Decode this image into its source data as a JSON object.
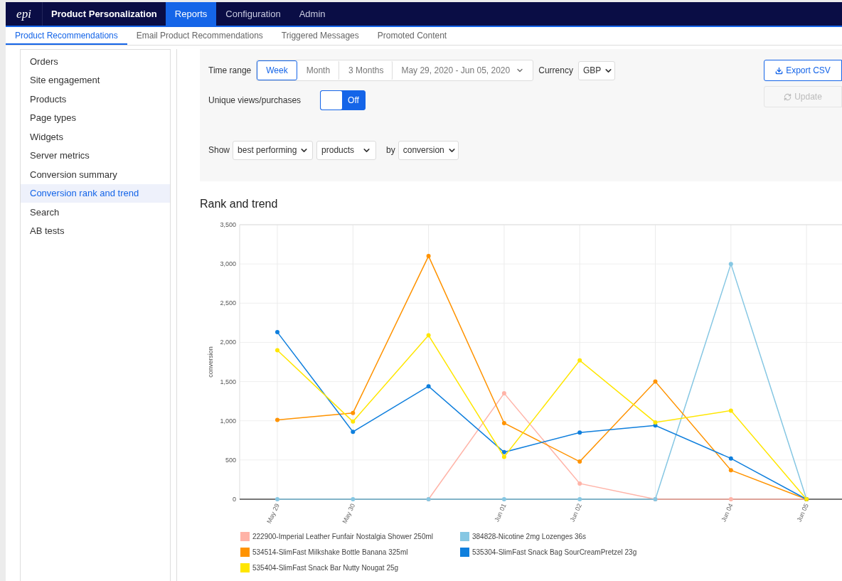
{
  "top_nav": {
    "logo": "epi",
    "product": "Product Personalization",
    "items": [
      {
        "label": "Reports",
        "selected": true
      },
      {
        "label": "Configuration",
        "selected": false
      },
      {
        "label": "Admin",
        "selected": false
      }
    ]
  },
  "sub_tabs": [
    {
      "label": "Product Recommendations",
      "selected": true
    },
    {
      "label": "Email Product Recommendations",
      "selected": false
    },
    {
      "label": "Triggered Messages",
      "selected": false
    },
    {
      "label": "Promoted Content",
      "selected": false
    }
  ],
  "sidebar": {
    "items": [
      {
        "label": "Orders",
        "selected": false
      },
      {
        "label": "Site engagement",
        "selected": false
      },
      {
        "label": "Products",
        "selected": false
      },
      {
        "label": "Page types",
        "selected": false
      },
      {
        "label": "Widgets",
        "selected": false
      },
      {
        "label": "Server metrics",
        "selected": false
      },
      {
        "label": "Conversion summary",
        "selected": false
      },
      {
        "label": "Conversion rank and trend",
        "selected": true
      },
      {
        "label": "Search",
        "selected": false
      },
      {
        "label": "AB tests",
        "selected": false
      }
    ]
  },
  "filters": {
    "time_range_label": "Time range",
    "time_ranges": [
      {
        "label": "Week",
        "selected": true
      },
      {
        "label": "Month",
        "selected": false
      },
      {
        "label": "3 Months",
        "selected": false
      }
    ],
    "date_range": "May 29, 2020 - Jun 05, 2020",
    "currency_label": "Currency",
    "currency": "GBP",
    "unique_toggle": {
      "label": "Unique views/purchases",
      "on": false,
      "text": "Off"
    },
    "show_label": "Show",
    "show": "best performing",
    "entity": "products",
    "by_label": "by",
    "metric": "conversion",
    "export_button": "Export CSV",
    "update_button": {
      "label": "Update",
      "disabled": true
    }
  },
  "chart_section": {
    "title": "Rank and trend",
    "chart_data": {
      "type": "line",
      "ylabel": "conversion",
      "grid": true,
      "categories": [
        "May 29",
        "May 30",
        null,
        "Jun 01",
        "Jun 02",
        null,
        "Jun 04",
        "Jun 05"
      ],
      "ylim": [
        0,
        3500
      ],
      "yticks": [
        {
          "value": 0,
          "label": "0"
        },
        {
          "value": 500,
          "label": "500"
        },
        {
          "value": 1000,
          "label": "1,000"
        },
        {
          "value": 1500,
          "label": "1,500"
        },
        {
          "value": 2000,
          "label": "2,000"
        },
        {
          "value": 2500,
          "label": "2,500"
        },
        {
          "value": 3000,
          "label": "3,000"
        },
        {
          "value": 3500,
          "label": "3,500"
        }
      ],
      "series": [
        {
          "name": "222900-Imperial Leather Funfair Nostalgia Shower 250ml",
          "color": "#ffb3a7",
          "marker": "circle",
          "values": [
            null,
            null,
            0,
            1350,
            200,
            0,
            0,
            0
          ]
        },
        {
          "name": "384828-Nicotine 2mg Lozenges 36s",
          "color": "#86c7e3",
          "marker": "circle",
          "values": [
            0,
            0,
            0,
            0,
            0,
            0,
            3000,
            0
          ]
        },
        {
          "name": "534514-SlimFast Milkshake Bottle Banana 325ml",
          "color": "#ff9300",
          "marker": "circle",
          "values": [
            1010,
            1100,
            3100,
            970,
            480,
            1500,
            370,
            0
          ]
        },
        {
          "name": "535304-SlimFast Snack Bag SourCreamPretzel 23g",
          "color": "#0f7fdd",
          "marker": "circle",
          "values": [
            2130,
            860,
            1440,
            600,
            850,
            940,
            520,
            0
          ]
        },
        {
          "name": "535404-SlimFast Snack Bar Nutty Nougat 25g",
          "color": "#ffe600",
          "marker": "circle",
          "values": [
            1900,
            990,
            2090,
            540,
            1770,
            980,
            1130,
            0
          ]
        }
      ]
    }
  }
}
